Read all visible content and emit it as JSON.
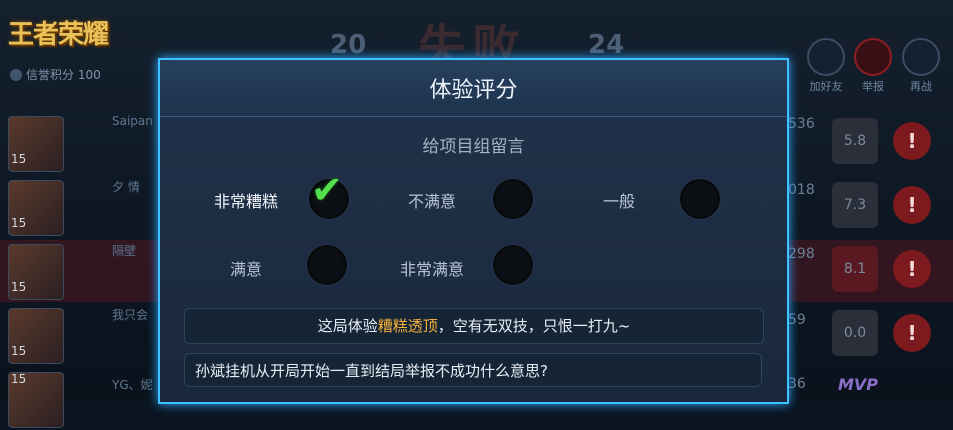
{
  "background": {
    "logo_text": "王者荣耀",
    "score_left": "20",
    "result": "失败",
    "score_right": "24",
    "credit": "信誉积分 100",
    "top_buttons": [
      {
        "label": "加好友"
      },
      {
        "label": "举报"
      },
      {
        "label": "再战"
      }
    ],
    "rows": [
      {
        "level": "15",
        "name": "Saipan",
        "kda": "536",
        "rating": "5.8"
      },
      {
        "level": "15",
        "name": "夕  情",
        "kda": "018",
        "rating": "7.3"
      },
      {
        "level": "15",
        "name": "隔壁",
        "kda": "298",
        "rating": "8.1"
      },
      {
        "level": "15",
        "name": "我只会",
        "kda": "59",
        "rating": "0.0"
      },
      {
        "level": "15",
        "name": "YG、妮",
        "kda": "36",
        "rating": ""
      }
    ],
    "mvp": "MVP"
  },
  "modal": {
    "title": "体验评分",
    "subtitle": "给项目组留言",
    "options": [
      {
        "label": "非常糟糕",
        "selected": true
      },
      {
        "label": "不满意",
        "selected": false
      },
      {
        "label": "一般",
        "selected": false
      },
      {
        "label": "满意",
        "selected": false
      },
      {
        "label": "非常满意",
        "selected": false
      }
    ],
    "quote": {
      "prefix": "这局体验",
      "highlight": "糟糕透顶",
      "suffix": "，空有无双技，只恨一打九~"
    },
    "comment": "孙斌挂机从开局开始一直到结局举报不成功什么意思?"
  }
}
